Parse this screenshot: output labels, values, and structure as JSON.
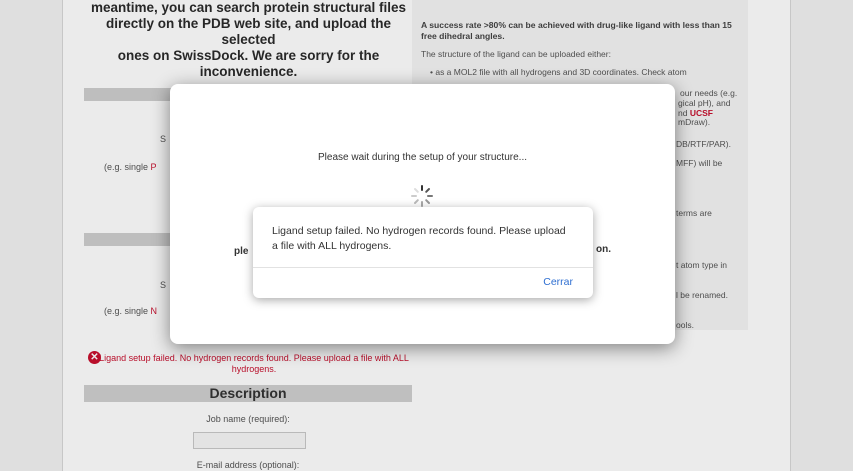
{
  "background_notice": {
    "lines": [
      "meantime, you can search protein structural files",
      "directly on the PDB web site, and upload the selected",
      "ones on SwissDock. We are sorry for the",
      "inconvenience."
    ]
  },
  "right_panel": {
    "success_note": "A success rate >80% can be achieved with drug-like ligand with less than 15 free dihedral angles.",
    "intro": "The structure of the ligand can be uploaded either:",
    "bullet1": "as a MOL2 file with all hydrogens and 3D coordinates. Check atom",
    "lines": [
      "our needs (e.g.",
      "gical pH), and",
      "nd UCSF",
      "mDraw).",
      "DB/RTF/PAR).",
      "MFF) will be",
      "terms are",
      "t atom type in",
      "l be renamed.",
      "ools."
    ]
  },
  "left_partials": {
    "s1": "S",
    "eg1": "(e.g. single",
    "eg1_red": "P",
    "s2": "S",
    "eg2": "(e.g. single",
    "eg2_red": "N"
  },
  "inline_error": "Ligand setup failed. No hydrogen records found. Please upload a file with ALL hydrogens.",
  "description": {
    "heading": "Description",
    "job_name_label": "Job name (required):",
    "email_label": "E-mail address (optional):"
  },
  "wait_dialog": {
    "message": "Please wait during the setup of your structure...",
    "partial_left": "ple",
    "partial_right": "on."
  },
  "alert": {
    "message": "Ligand setup failed. No hydrogen records found. Please upload a file with ALL hydrogens.",
    "button": "Cerrar"
  },
  "colors": {
    "error_red": "#c8102e",
    "link_blue": "#2f6fd1"
  }
}
